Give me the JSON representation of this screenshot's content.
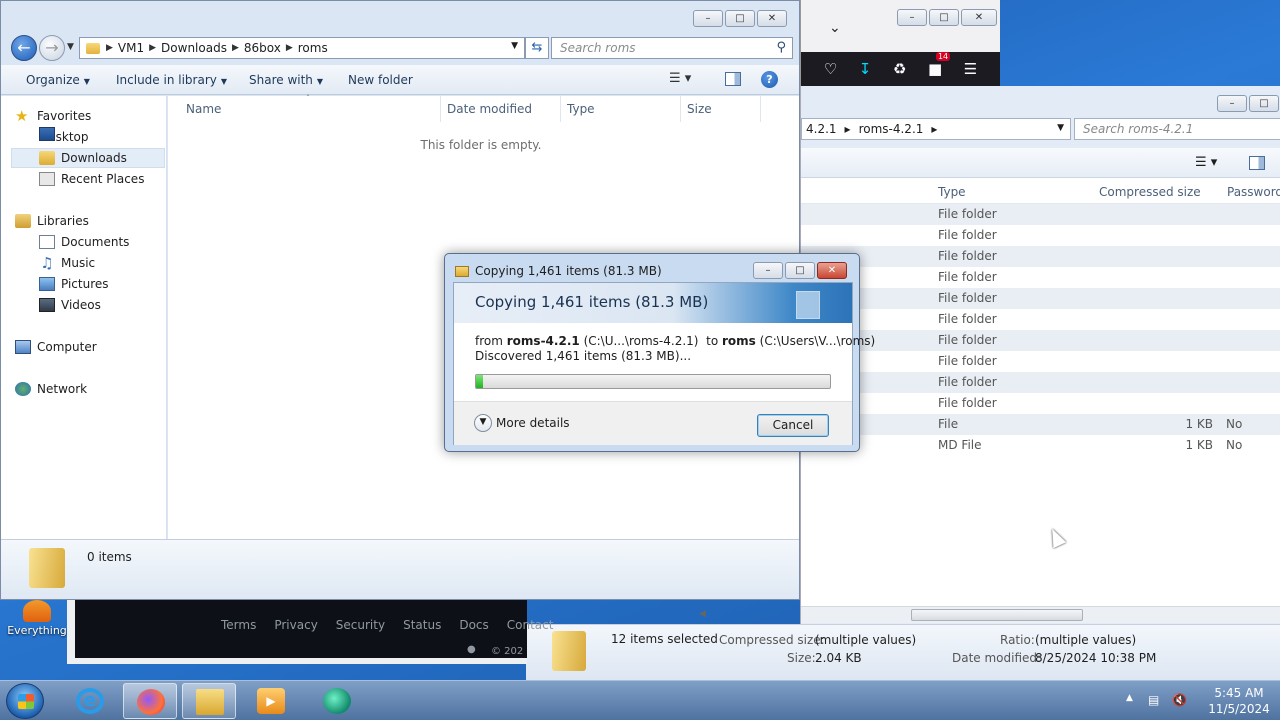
{
  "desktop": {
    "icon_label": "Everything"
  },
  "browser": {
    "badge_count": "14"
  },
  "zip_window": {
    "address_crumbs": [
      "4.2.1",
      "roms-4.2.1"
    ],
    "search_placeholder": "Search roms-4.2.1",
    "columns": [
      "Type",
      "Compressed size",
      "Password"
    ],
    "rows": [
      {
        "type": "File folder",
        "size": "",
        "password": ""
      },
      {
        "type": "File folder",
        "size": "",
        "password": ""
      },
      {
        "type": "File folder",
        "size": "",
        "password": ""
      },
      {
        "type": "File folder",
        "size": "",
        "password": ""
      },
      {
        "type": "File folder",
        "size": "",
        "password": ""
      },
      {
        "type": "File folder",
        "size": "",
        "password": ""
      },
      {
        "type": "File folder",
        "size": "",
        "password": ""
      },
      {
        "type": "File folder",
        "size": "",
        "password": ""
      },
      {
        "type": "File folder",
        "size": "",
        "password": ""
      },
      {
        "type": "File folder",
        "size": "",
        "password": ""
      },
      {
        "type": "File",
        "size": "1 KB",
        "password": "No"
      },
      {
        "type": "MD File",
        "size": "1 KB",
        "password": "No"
      }
    ],
    "details": {
      "selected": "12 items selected",
      "compressed_label": "Compressed size:",
      "compressed_value": "(multiple values)",
      "size_label": "Size:",
      "size_value": "2.04 KB",
      "ratio_label": "Ratio:",
      "ratio_value": "(multiple values)",
      "modified_label": "Date modified:",
      "modified_value": "8/25/2024 10:38 PM"
    }
  },
  "web_footer": {
    "links": [
      "Terms",
      "Privacy",
      "Security",
      "Status",
      "Docs",
      "Contact"
    ],
    "copyright": "© 202"
  },
  "explorer": {
    "address_crumbs": [
      "VM1",
      "Downloads",
      "86box",
      "roms"
    ],
    "search_placeholder": "Search roms",
    "commands": {
      "organize": "Organize",
      "include_library": "Include in library",
      "share_with": "Share with",
      "new_folder": "New folder"
    },
    "nav": {
      "favorites": "Favorites",
      "desktop": "Desktop",
      "downloads": "Downloads",
      "recent": "Recent Places",
      "libraries": "Libraries",
      "documents": "Documents",
      "music": "Music",
      "pictures": "Pictures",
      "videos": "Videos",
      "computer": "Computer",
      "network": "Network"
    },
    "columns": {
      "name": "Name",
      "date_modified": "Date modified",
      "type": "Type",
      "size": "Size"
    },
    "empty_message": "This folder is empty.",
    "item_count": "0 items"
  },
  "copy_dialog": {
    "title": "Copying 1,461 items (81.3 MB)",
    "heading": "Copying 1,461 items (81.3 MB)",
    "from_prefix": "from",
    "from_name": "roms-4.2.1",
    "from_path": "(C:\\U...\\roms-4.2.1)",
    "to_prefix": "to",
    "to_name": "roms",
    "to_path": "(C:\\Users\\V...\\roms)",
    "discovered": "Discovered 1,461 items (81.3 MB)...",
    "progress_fraction": 0.02,
    "more_details": "More details",
    "cancel": "Cancel"
  },
  "taskbar": {
    "time": "5:45 AM",
    "date": "11/5/2024"
  }
}
